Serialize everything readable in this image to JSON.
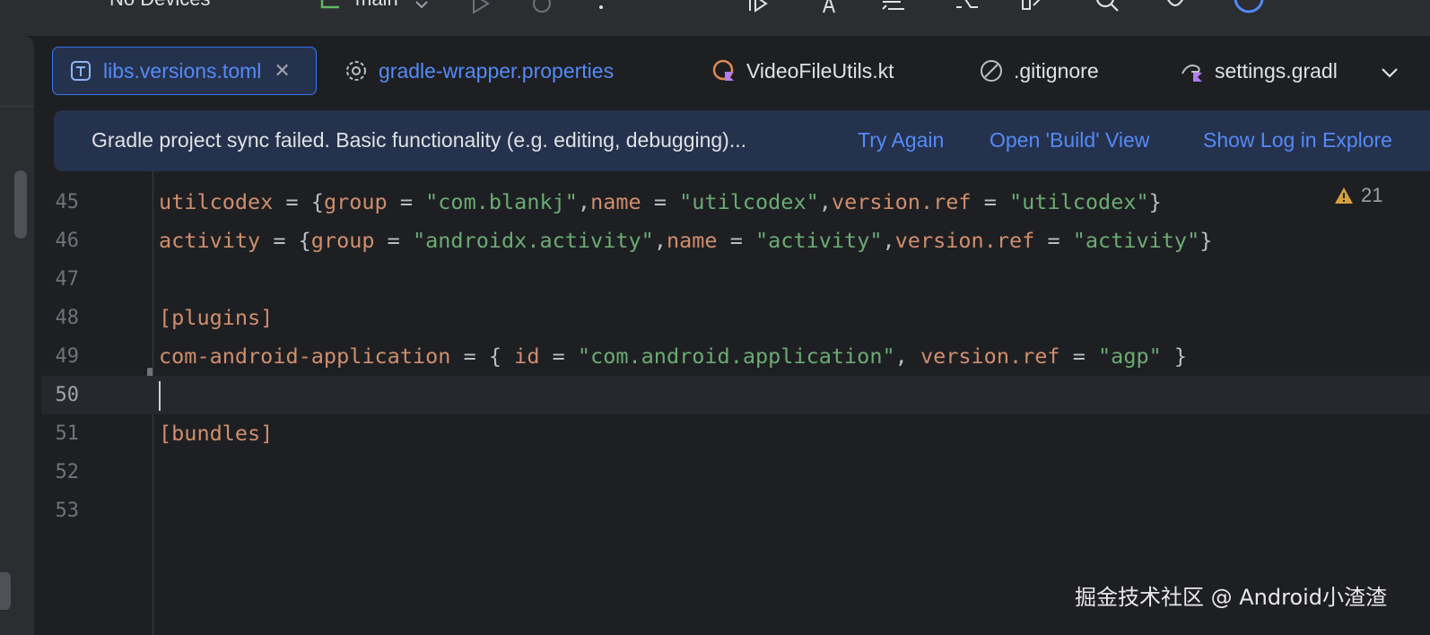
{
  "toolbar": {
    "device_label": "No Devices",
    "branch_label": "main"
  },
  "tabs": [
    {
      "label": "libs.versions.toml",
      "icon": "toml-file-icon",
      "active": true,
      "close": "✕"
    },
    {
      "label": "gradle-wrapper.properties",
      "icon": "gear-icon",
      "active": false
    },
    {
      "label": "VideoFileUtils.kt",
      "icon": "kotlin-file-icon",
      "active": false
    },
    {
      "label": ".gitignore",
      "icon": "ignore-file-icon",
      "active": false
    },
    {
      "label": "settings.gradl",
      "icon": "gradle-file-icon",
      "active": false
    }
  ],
  "banner": {
    "message": "Gradle project sync failed. Basic functionality (e.g. editing, debugging)...",
    "actions": [
      "Try Again",
      "Open 'Build' View",
      "Show Log in Explore"
    ]
  },
  "editor": {
    "warning_count": "21",
    "lines": [
      {
        "number": "45"
      },
      {
        "number": "46"
      },
      {
        "number": "47"
      },
      {
        "number": "48"
      },
      {
        "number": "49"
      },
      {
        "number": "50"
      },
      {
        "number": "51"
      },
      {
        "number": "52"
      },
      {
        "number": "53"
      }
    ],
    "code": {
      "l45": [
        "utilcodex",
        " = {",
        "group",
        " = ",
        "\"com.blankj\"",
        ",",
        "name",
        " = ",
        "\"utilcodex\"",
        ",",
        "version.ref",
        " = ",
        "\"utilcodex\"",
        "}"
      ],
      "l46": [
        "activity",
        " = {",
        "group",
        " = ",
        "\"androidx.activity\"",
        ",",
        "name",
        " = ",
        "\"activity\"",
        ",",
        "version.ref",
        " = ",
        "\"activity\"",
        "}"
      ],
      "l48": "[plugins]",
      "l49": [
        "com-android-application",
        " = { ",
        "id",
        " = ",
        "\"com.android.application\"",
        ", ",
        "version.ref",
        " = ",
        "\"agp\"",
        " }"
      ],
      "l51": "[bundles]"
    }
  },
  "watermark": "掘金技术社区 @ Android小渣渣",
  "colors": {
    "accent": "#3574f0",
    "link": "#548af7",
    "keyword": "#cf8e6d",
    "string": "#6aab73",
    "background": "#1e1f22"
  }
}
